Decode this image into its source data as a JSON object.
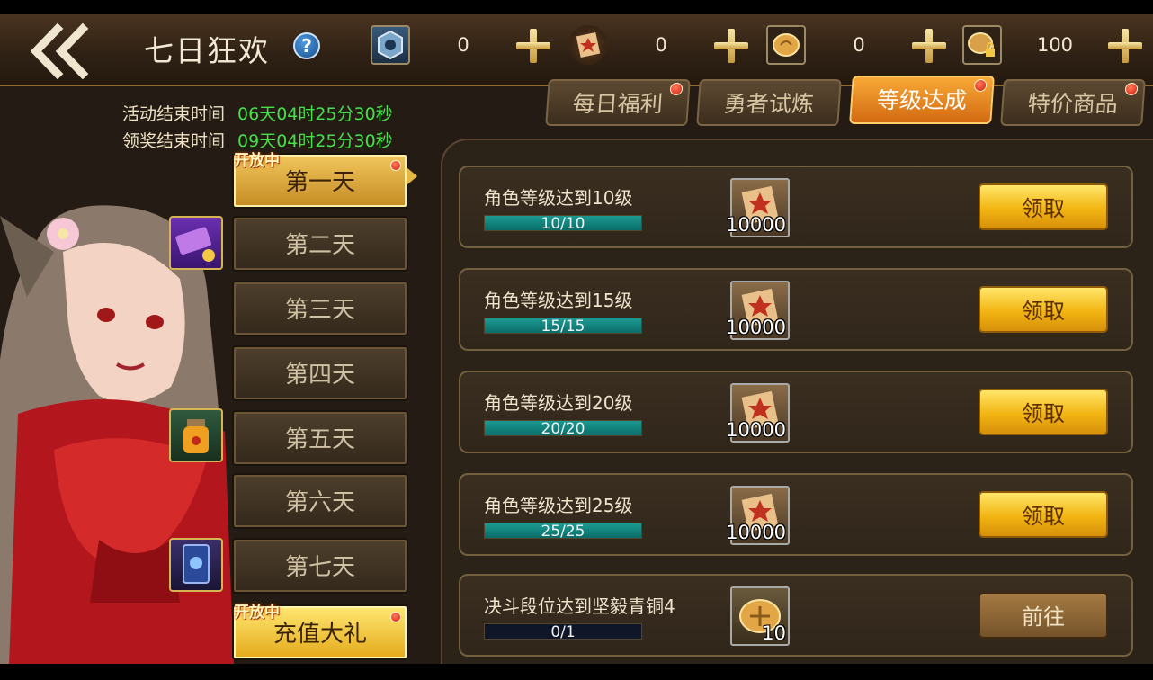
{
  "header": {
    "title": "七日狂欢",
    "help_symbol": "?",
    "resources": [
      {
        "icon": "shield-token-icon",
        "value": "0"
      },
      {
        "icon": "scroll-ticket-icon",
        "value": "0"
      },
      {
        "icon": "gold-coin-icon",
        "value": "0"
      },
      {
        "icon": "locked-coin-icon",
        "value": "100"
      }
    ]
  },
  "tabs": [
    {
      "label": "每日福利",
      "active": false,
      "dot": true
    },
    {
      "label": "勇者试炼",
      "active": false,
      "dot": false
    },
    {
      "label": "等级达成",
      "active": true,
      "dot": true
    },
    {
      "label": "特价商品",
      "active": false,
      "dot": true
    }
  ],
  "timers": {
    "event_end_label": "活动结束时间",
    "event_end_value": "06天04时25分30秒",
    "claim_end_label": "领奖结束时间",
    "claim_end_value": "09天04时25分30秒"
  },
  "days": [
    {
      "label": "第一天",
      "active": true,
      "flag": "开放中",
      "dot": true
    },
    {
      "label": "第二天",
      "active": false
    },
    {
      "label": "第三天",
      "active": false
    },
    {
      "label": "第四天",
      "active": false
    },
    {
      "label": "第五天",
      "active": false
    },
    {
      "label": "第六天",
      "active": false
    },
    {
      "label": "第七天",
      "active": false
    },
    {
      "label": "充值大礼",
      "active": false,
      "flag": "开放中",
      "dot": true,
      "gold": true
    }
  ],
  "tasks": [
    {
      "title": "角色等级达到10级",
      "progress_text": "10/10",
      "progress": 1.0,
      "reward_icon": "scroll-reward-icon",
      "reward_count": "10000",
      "button": "领取",
      "button_type": "claim"
    },
    {
      "title": "角色等级达到15级",
      "progress_text": "15/15",
      "progress": 1.0,
      "reward_icon": "scroll-reward-icon",
      "reward_count": "10000",
      "button": "领取",
      "button_type": "claim"
    },
    {
      "title": "角色等级达到20级",
      "progress_text": "20/20",
      "progress": 1.0,
      "reward_icon": "scroll-reward-icon",
      "reward_count": "10000",
      "button": "领取",
      "button_type": "claim"
    },
    {
      "title": "角色等级达到25级",
      "progress_text": "25/25",
      "progress": 1.0,
      "reward_icon": "scroll-reward-icon",
      "reward_count": "10000",
      "button": "领取",
      "button_type": "claim"
    },
    {
      "title": "决斗段位达到坚毅青铜4",
      "progress_text": "0/1",
      "progress": 0.0,
      "reward_icon": "gold-coin-reward-icon",
      "reward_count": "10",
      "button": "前往",
      "button_type": "goto"
    }
  ],
  "colors": {
    "accent_orange": "#e8891f",
    "progress_teal": "#14857f",
    "timer_green": "#46e04a",
    "claim_gold": "#f2b512"
  }
}
